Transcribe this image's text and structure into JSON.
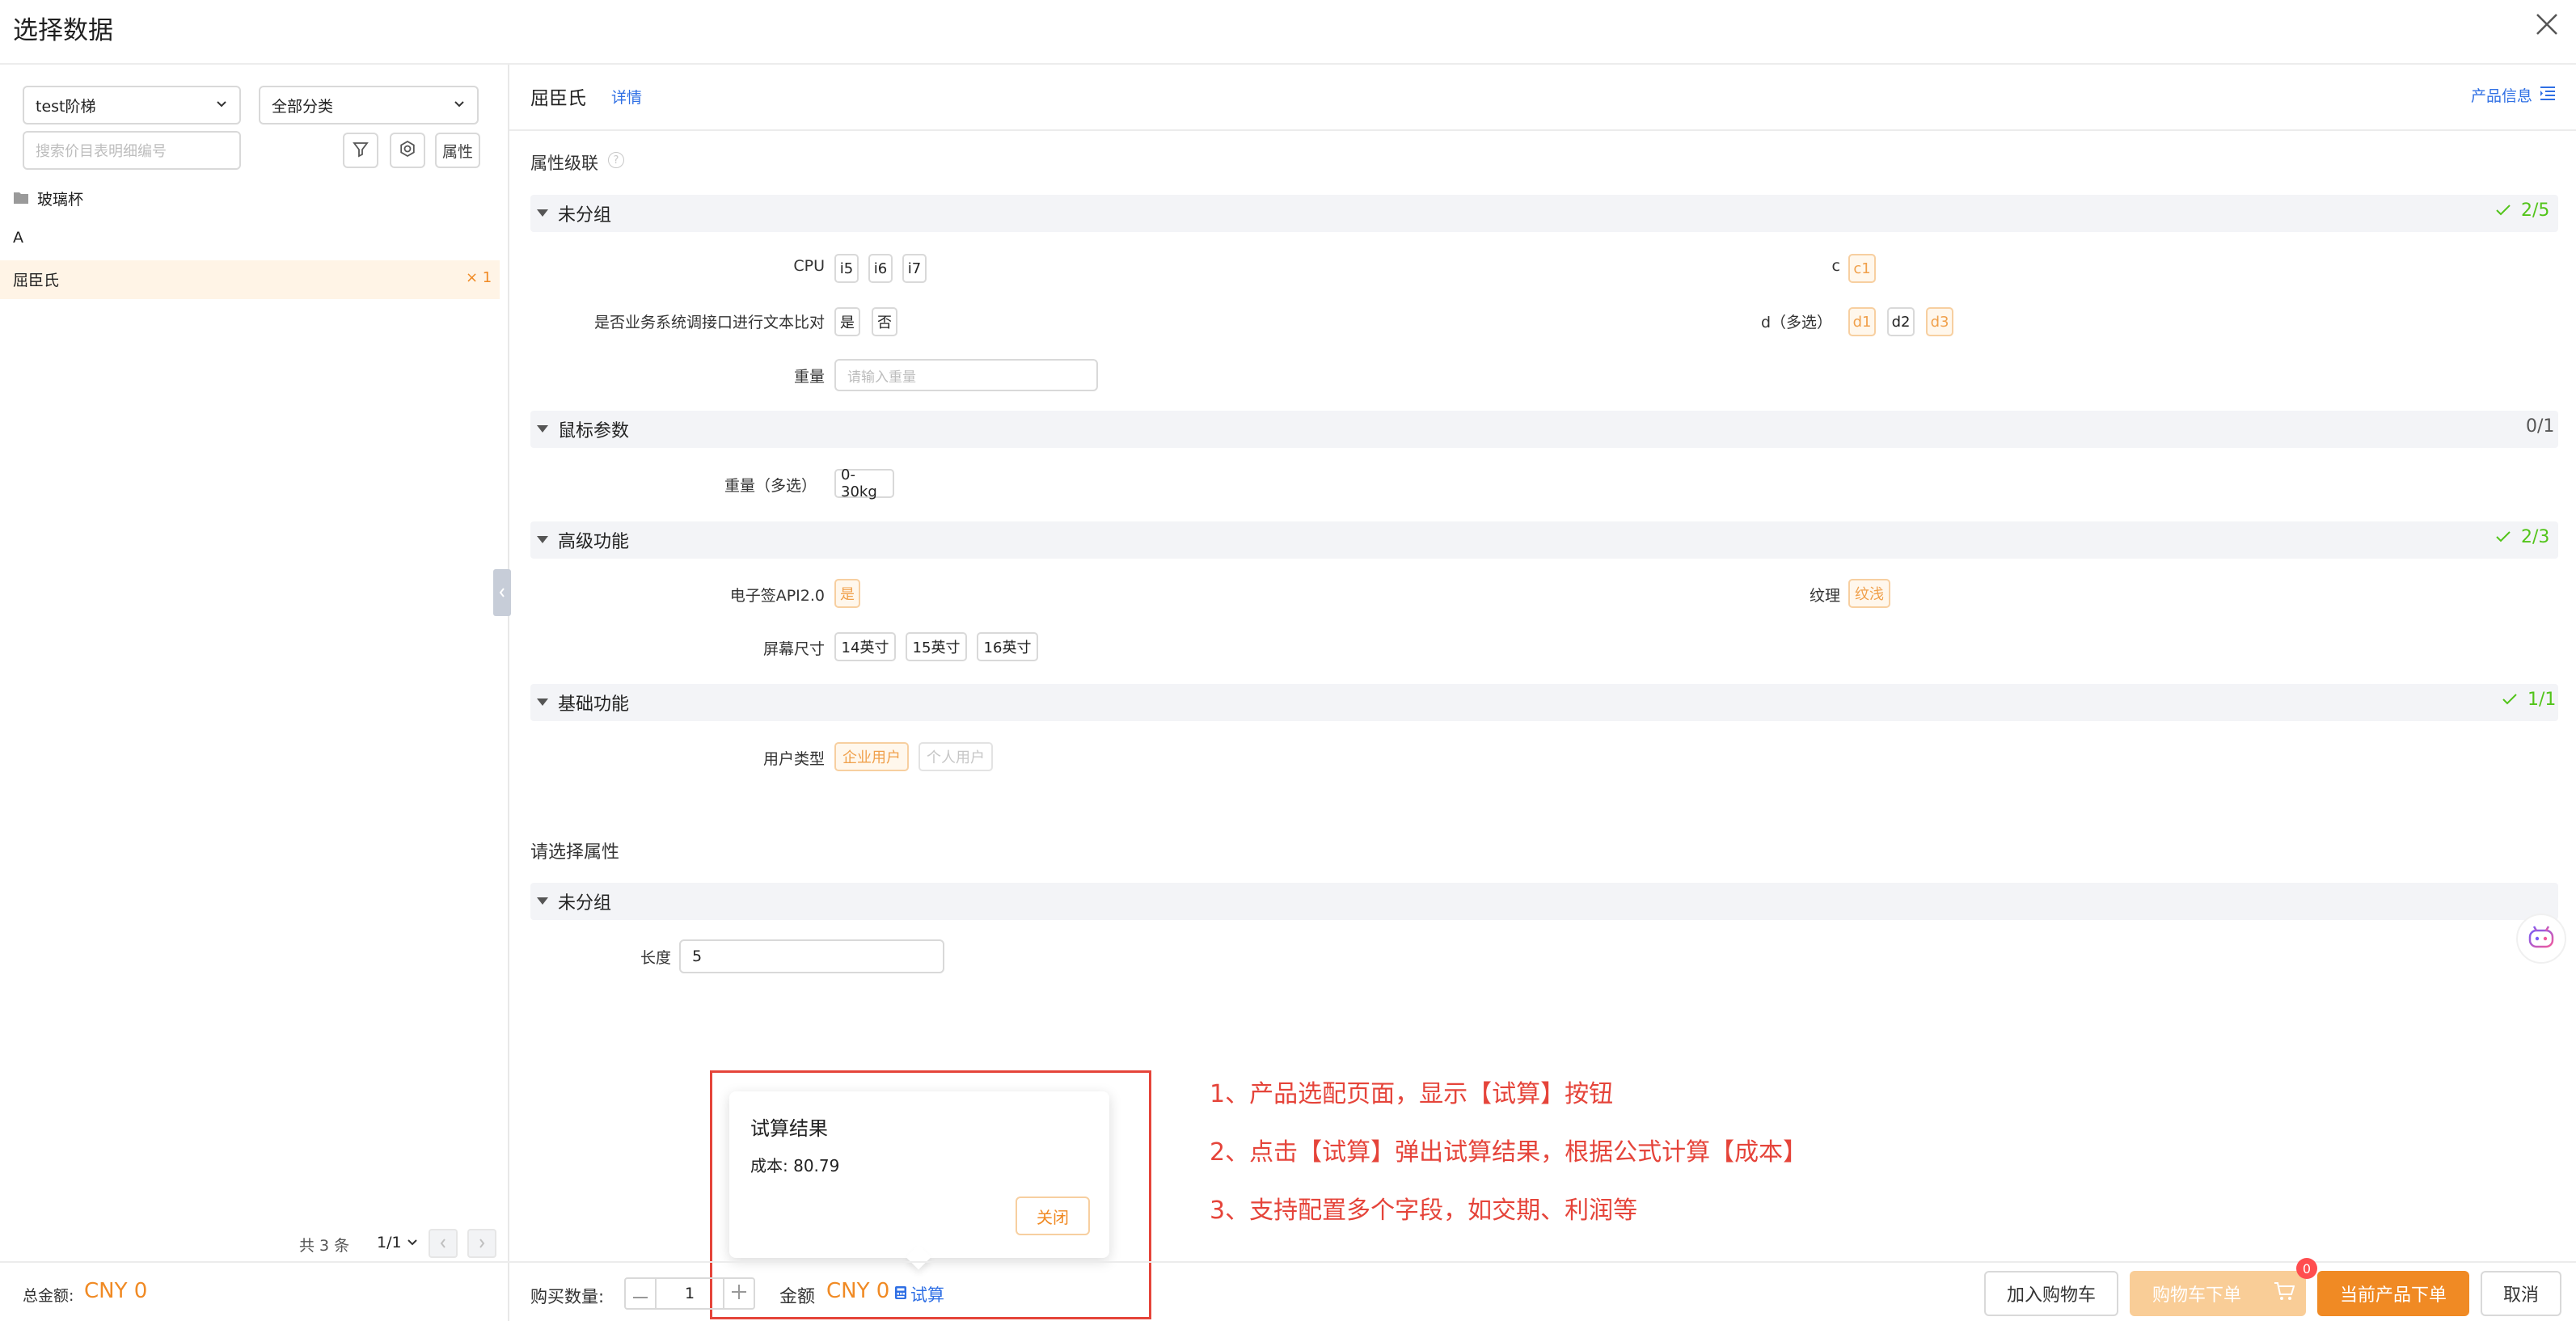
{
  "dialog": {
    "title": "选择数据"
  },
  "left": {
    "select1": "test阶梯",
    "select2": "全部分类",
    "search_placeholder": "搜索价目表明细编号",
    "attr_btn": "属性",
    "tree": {
      "folder": "玻璃杯",
      "letter": "A",
      "item": "屈臣氏",
      "item_count": "× 1"
    },
    "pagination": {
      "total": "共 3 条",
      "page": "1/1"
    },
    "total": {
      "label": "总金额:",
      "value": "CNY 0"
    }
  },
  "right": {
    "product": "屈臣氏",
    "detail_link": "详情",
    "product_info": "产品信息",
    "cascade_title": "属性级联",
    "groups": [
      {
        "name": "未分组",
        "count": "2/5",
        "rows": [
          {
            "label": "CPU",
            "options": [
              "i5",
              "i6",
              "i7"
            ]
          },
          {
            "label": "是否业务系统调接口进行文本比对",
            "options": [
              "是",
              "否"
            ]
          },
          {
            "label": "重量",
            "placeholder": "请输入重量"
          },
          {
            "label": "c",
            "options": [
              "c1"
            ]
          },
          {
            "label": "d（多选）",
            "options": [
              "d1",
              "d2",
              "d3"
            ]
          }
        ]
      },
      {
        "name": "鼠标参数",
        "count": "0/1",
        "rows": [
          {
            "label": "重量（多选）",
            "options": [
              "0-30kg"
            ]
          }
        ]
      },
      {
        "name": "高级功能",
        "count": "2/3",
        "rows": [
          {
            "label": "电子签API2.0",
            "options": [
              "是"
            ]
          },
          {
            "label": "屏幕尺寸",
            "options": [
              "14英寸",
              "15英寸",
              "16英寸"
            ]
          },
          {
            "label": "纹理",
            "options": [
              "纹浅"
            ]
          }
        ]
      },
      {
        "name": "基础功能",
        "count": "1/1",
        "rows": [
          {
            "label": "用户类型",
            "options": [
              "企业用户",
              "个人用户"
            ]
          }
        ]
      }
    ],
    "select_attr_title": "请选择属性",
    "attr_group": {
      "name": "未分组",
      "field_label": "长度",
      "field_value": "5"
    }
  },
  "popup": {
    "title": "试算结果",
    "result": "成本: 80.79",
    "close": "关闭"
  },
  "annotations": [
    "1、产品选配页面，显示【试算】按钮",
    "2、点击【试算】弹出试算结果，根据公式计算【成本】",
    "3、支持配置多个字段，如交期、利润等"
  ],
  "footer": {
    "qty_label": "购买数量:",
    "qty_value": "1",
    "amount_label": "金额",
    "amount_value": "CNY 0",
    "calc": "试算",
    "add_cart": "加入购物车",
    "cart_order": "购物车下单",
    "cart_badge": "0",
    "current_order": "当前产品下单",
    "cancel": "取消"
  },
  "colors": {
    "accent": "#f08a24",
    "link": "#2f6fe4",
    "ok": "#52c41a",
    "annotation": "#e5443a"
  }
}
